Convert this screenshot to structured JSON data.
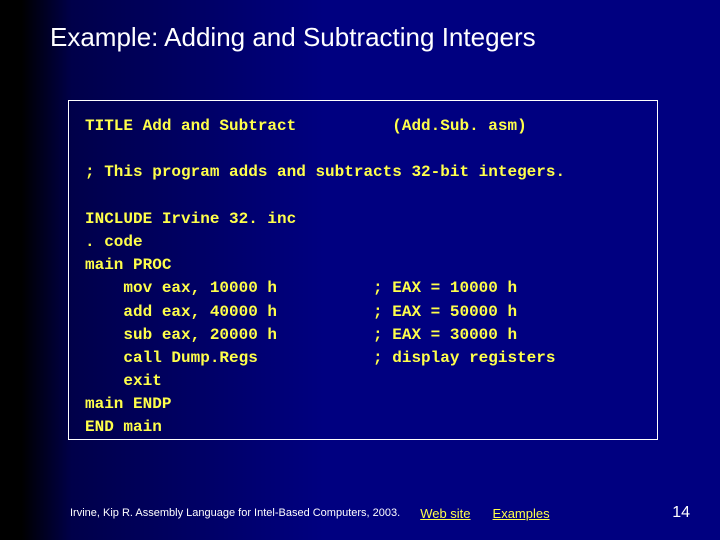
{
  "title": "Example: Adding and Subtracting Integers",
  "code": {
    "line1a": "TITLE Add and Subtract",
    "line1b": "(Add.Sub. asm)",
    "line2": "; This program adds and subtracts 32-bit integers.",
    "line3": "INCLUDE Irvine 32. inc",
    "line4": ". code",
    "line5": "main PROC",
    "line6a": "    mov eax, 10000 h",
    "line6b": "; EAX = 10000 h",
    "line7a": "    add eax, 40000 h",
    "line7b": "; EAX = 50000 h",
    "line8a": "    sub eax, 20000 h",
    "line8b": "; EAX = 30000 h",
    "line9a": "    call Dump.Regs",
    "line9b": "; display registers",
    "line10": "    exit",
    "line11": "main ENDP",
    "line12": "END main"
  },
  "footer": {
    "credit": "Irvine, Kip R. Assembly Language for Intel-Based Computers, 2003.",
    "link1": "Web site",
    "link2": "Examples",
    "page": "14"
  }
}
